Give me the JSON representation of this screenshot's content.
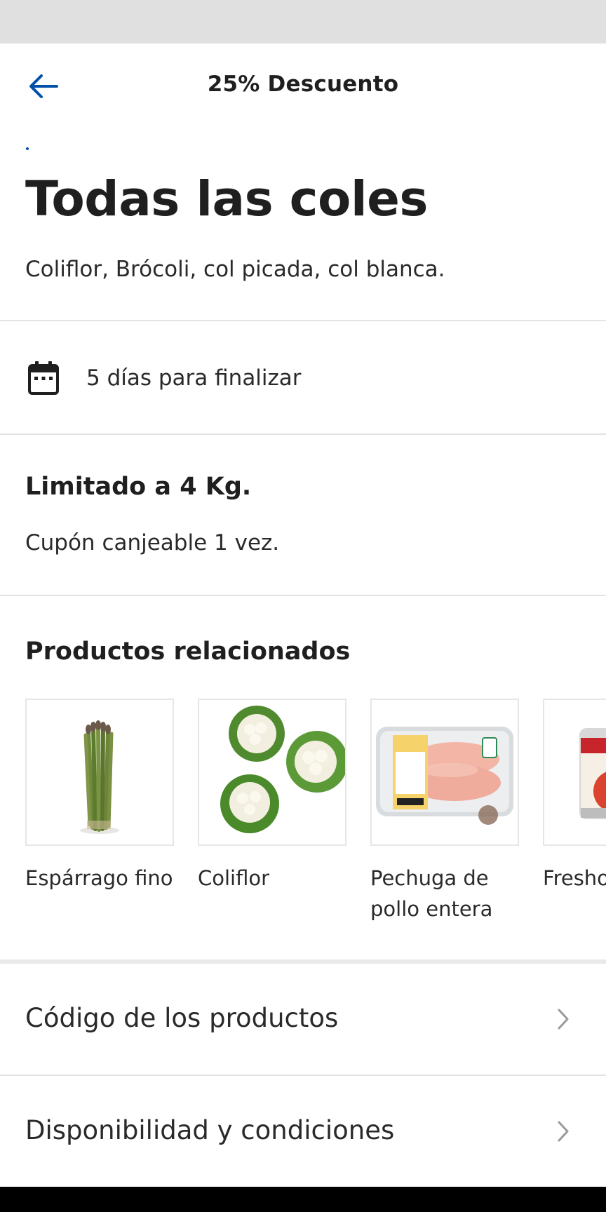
{
  "header": {
    "title": "25% Descuento",
    "back_icon": "arrow-left-icon",
    "accent_color": "#0050aa"
  },
  "offer": {
    "title": "Todas las coles",
    "description": "Coliflor, Brócoli, col picada, col blanca."
  },
  "expiry": {
    "icon": "calendar-icon",
    "text": "5 días para finalizar"
  },
  "conditions": {
    "limit_title": "Limitado a 4 Kg.",
    "limit_text": "Cupón canjeable 1 vez."
  },
  "related": {
    "title": "Productos relacionados",
    "products": [
      {
        "name": "Espárrago fino",
        "image": "asparagus-image"
      },
      {
        "name": "Coliflor",
        "image": "cauliflower-image"
      },
      {
        "name": "Pechuga de pollo entera",
        "image": "chicken-breast-image"
      },
      {
        "name": "Fresho Tomate",
        "image": "tomato-can-image"
      }
    ]
  },
  "links": {
    "product_codes": "Código de los productos",
    "availability": "Disponibilidad y condiciones",
    "chevron_icon": "chevron-right-icon"
  }
}
